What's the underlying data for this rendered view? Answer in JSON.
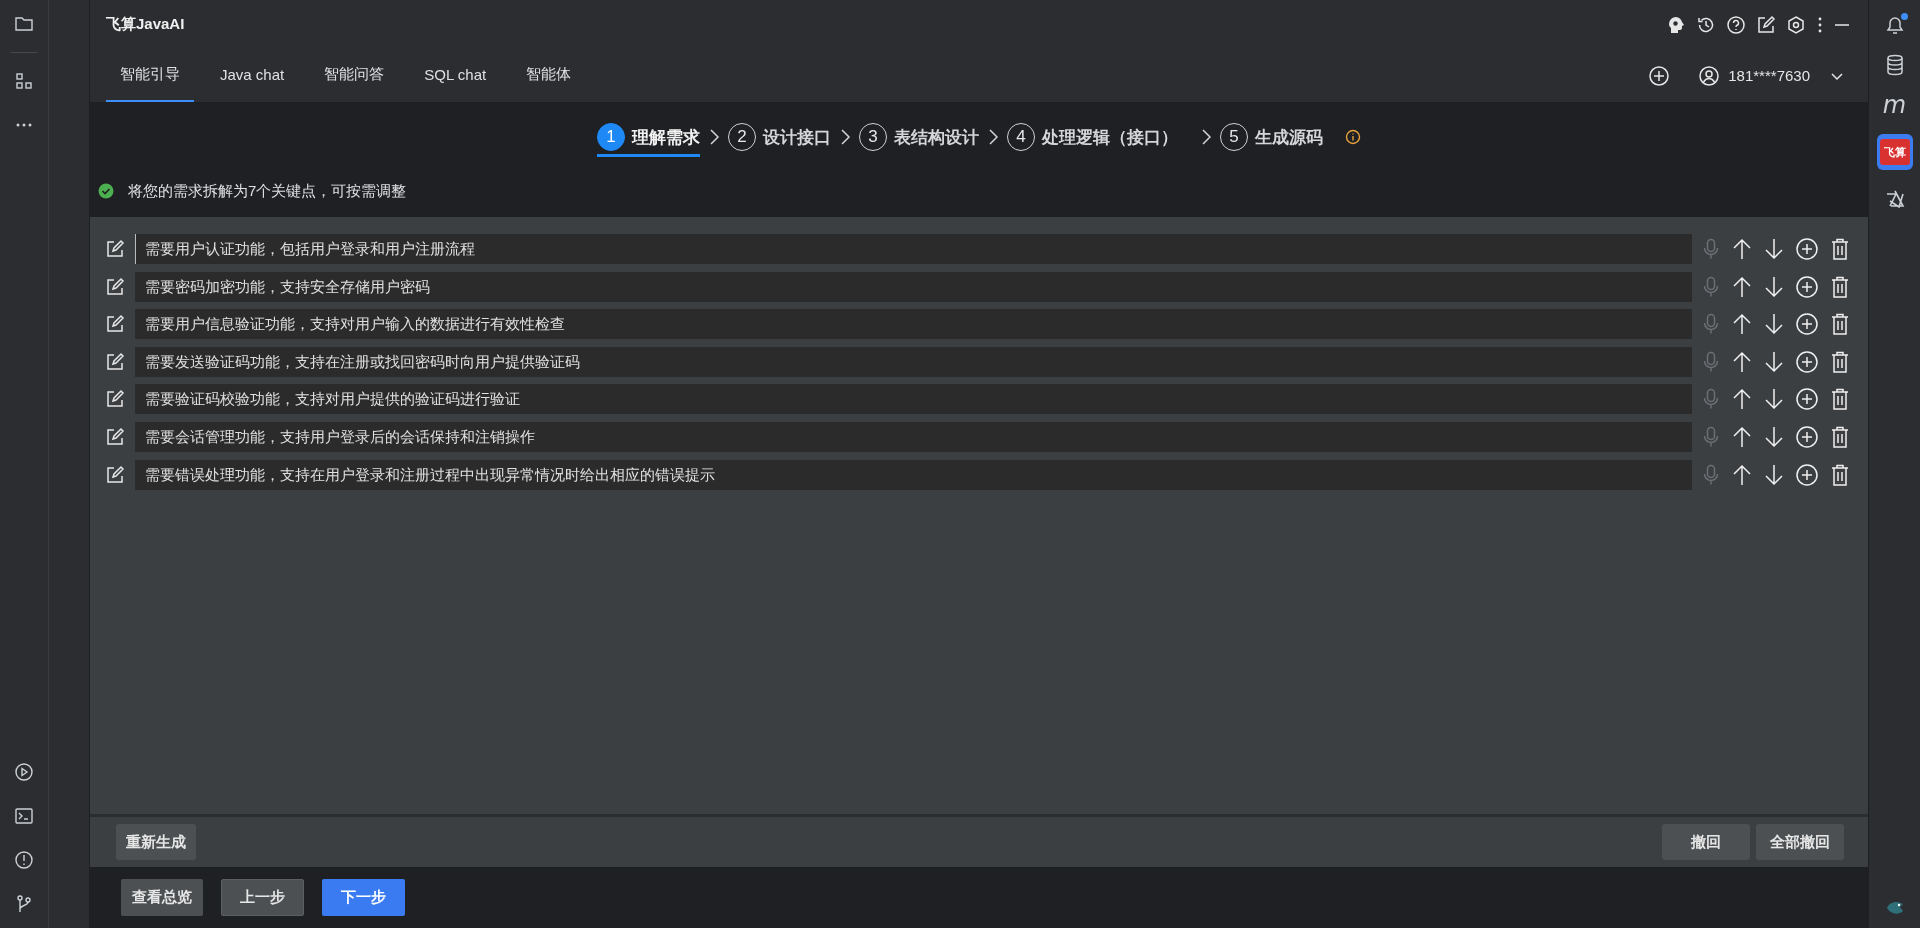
{
  "app": {
    "title": "飞算JavaAI"
  },
  "tabs": [
    {
      "label": "智能引导",
      "selected": true
    },
    {
      "label": "Java chat",
      "selected": false
    },
    {
      "label": "智能问答",
      "selected": false
    },
    {
      "label": "SQL chat",
      "selected": false
    },
    {
      "label": "智能体",
      "selected": false
    }
  ],
  "account": {
    "phone": "181****7630"
  },
  "steps": [
    {
      "number": "1",
      "label": "理解需求",
      "selected": true
    },
    {
      "number": "2",
      "label": "设计接口",
      "selected": false
    },
    {
      "number": "3",
      "label": "表结构设计",
      "selected": false
    },
    {
      "number": "4",
      "label": "处理逻辑（接口）",
      "selected": false
    },
    {
      "number": "5",
      "label": "生成源码",
      "selected": false
    }
  ],
  "notice": "将您的需求拆解为7个关键点，可按需调整",
  "requirements": [
    {
      "text": "需要用户认证功能，包括用户登录和用户注册流程",
      "focused": true
    },
    {
      "text": "需要密码加密功能，支持安全存储用户密码",
      "focused": false
    },
    {
      "text": "需要用户信息验证功能，支持对用户输入的数据进行有效性检查",
      "focused": false
    },
    {
      "text": "需要发送验证码功能，支持在注册或找回密码时向用户提供验证码",
      "focused": false
    },
    {
      "text": "需要验证码校验功能，支持对用户提供的验证码进行验证",
      "focused": false
    },
    {
      "text": "需要会话管理功能，支持用户登录后的会话保持和注销操作",
      "focused": false
    },
    {
      "text": "需要错误处理功能，支持在用户登录和注册过程中出现异常情况时给出相应的错误提示",
      "focused": false
    }
  ],
  "action_bar": {
    "regenerate": "重新生成",
    "undo": "撤回",
    "undo_all": "全部撤回"
  },
  "footer_buttons": [
    {
      "label": "查看总览",
      "kind": "secondary"
    },
    {
      "label": "上一步",
      "kind": "outline"
    },
    {
      "label": "下一步",
      "kind": "primary"
    }
  ],
  "right_sidebar": {
    "unread_notifications": true,
    "m_label": "m",
    "plugin_label": "飞算"
  }
}
